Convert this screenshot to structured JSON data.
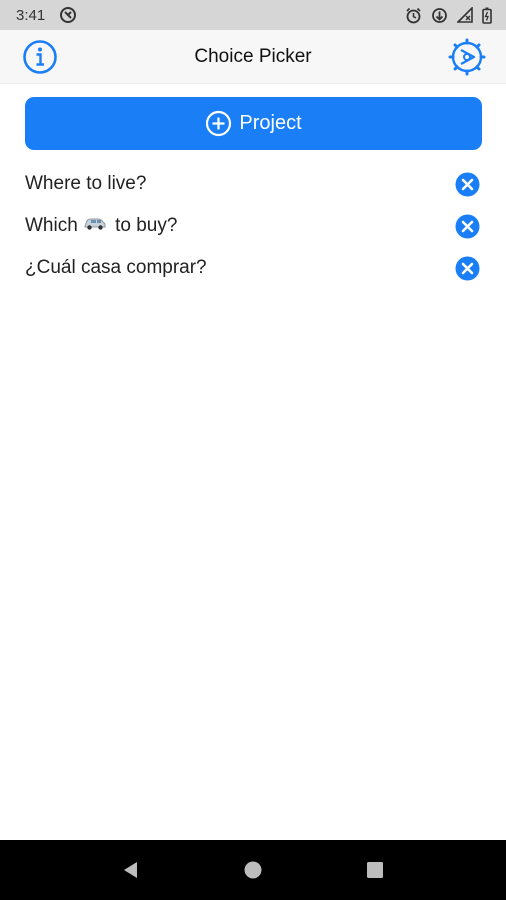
{
  "status_bar": {
    "time": "3:41",
    "icons": [
      "notification-icon",
      "alarm-icon",
      "data-saver-icon",
      "signal-icon",
      "battery-icon"
    ]
  },
  "app_bar": {
    "title": "Choice Picker",
    "left_icon": "info-icon",
    "right_icon": "settings-icon"
  },
  "add_button": {
    "label": "Project",
    "icon": "plus-circle-icon"
  },
  "projects": [
    {
      "label": "Where to live?"
    },
    {
      "label_before": "Which",
      "emoji": "car-icon",
      "label_after": "to buy?"
    },
    {
      "label": "¿Cuál casa comprar?"
    }
  ],
  "colors": {
    "accent": "#1a7ef7",
    "status_bar": "#d6d6d6",
    "nav_bar": "#000000"
  }
}
